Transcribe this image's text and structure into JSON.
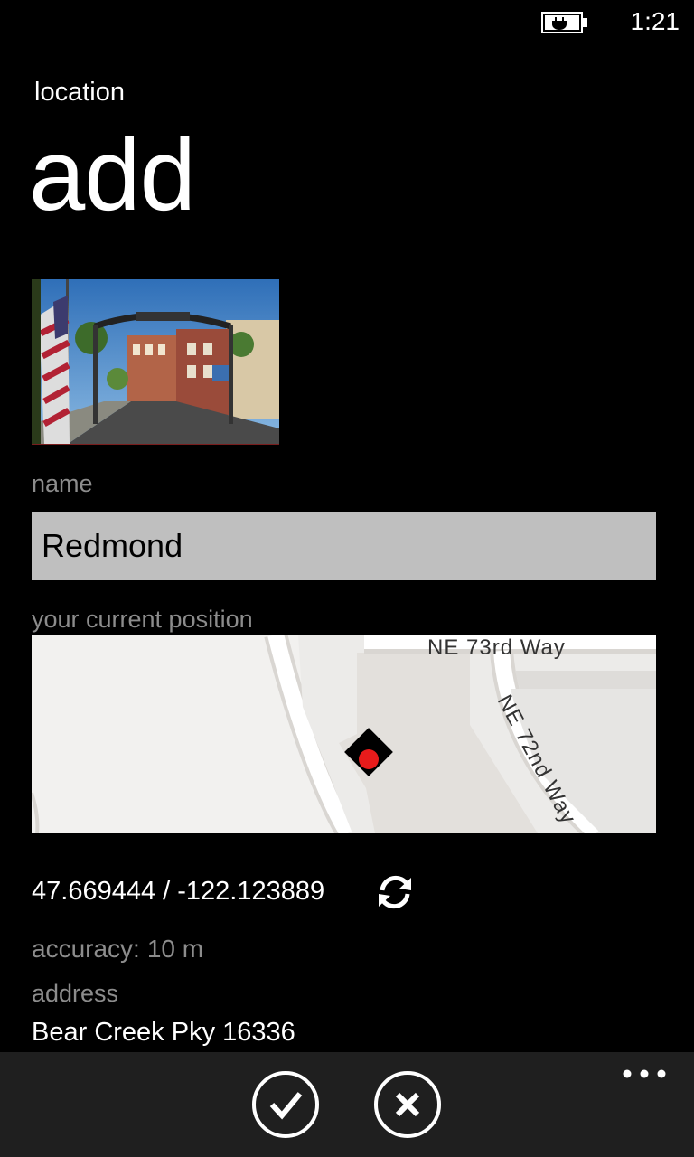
{
  "status_bar": {
    "time": "1:21",
    "battery_icon": "battery-charging-icon"
  },
  "header": {
    "app_title": "location",
    "page_title": "add"
  },
  "photo": {
    "description_icon": "photo-thumbnail"
  },
  "form": {
    "name_label": "name",
    "name_value": "Redmond",
    "position_label": "your current position",
    "coordinates": "47.669444 / -122.123889",
    "accuracy_label": "accuracy:",
    "accuracy_value": "10 m",
    "address_label": "address",
    "address_value": "Bear Creek Pky 16336"
  },
  "map": {
    "street_labels": [
      "NE 73rd Way",
      "NE 72nd Way"
    ],
    "marker_icon": "location-pin-icon",
    "marker_color": "#e81b1b"
  },
  "app_bar": {
    "buttons": [
      {
        "name": "confirm-button",
        "icon": "checkmark-icon"
      },
      {
        "name": "cancel-button",
        "icon": "close-icon"
      }
    ],
    "more_icon": "ellipsis-icon"
  }
}
